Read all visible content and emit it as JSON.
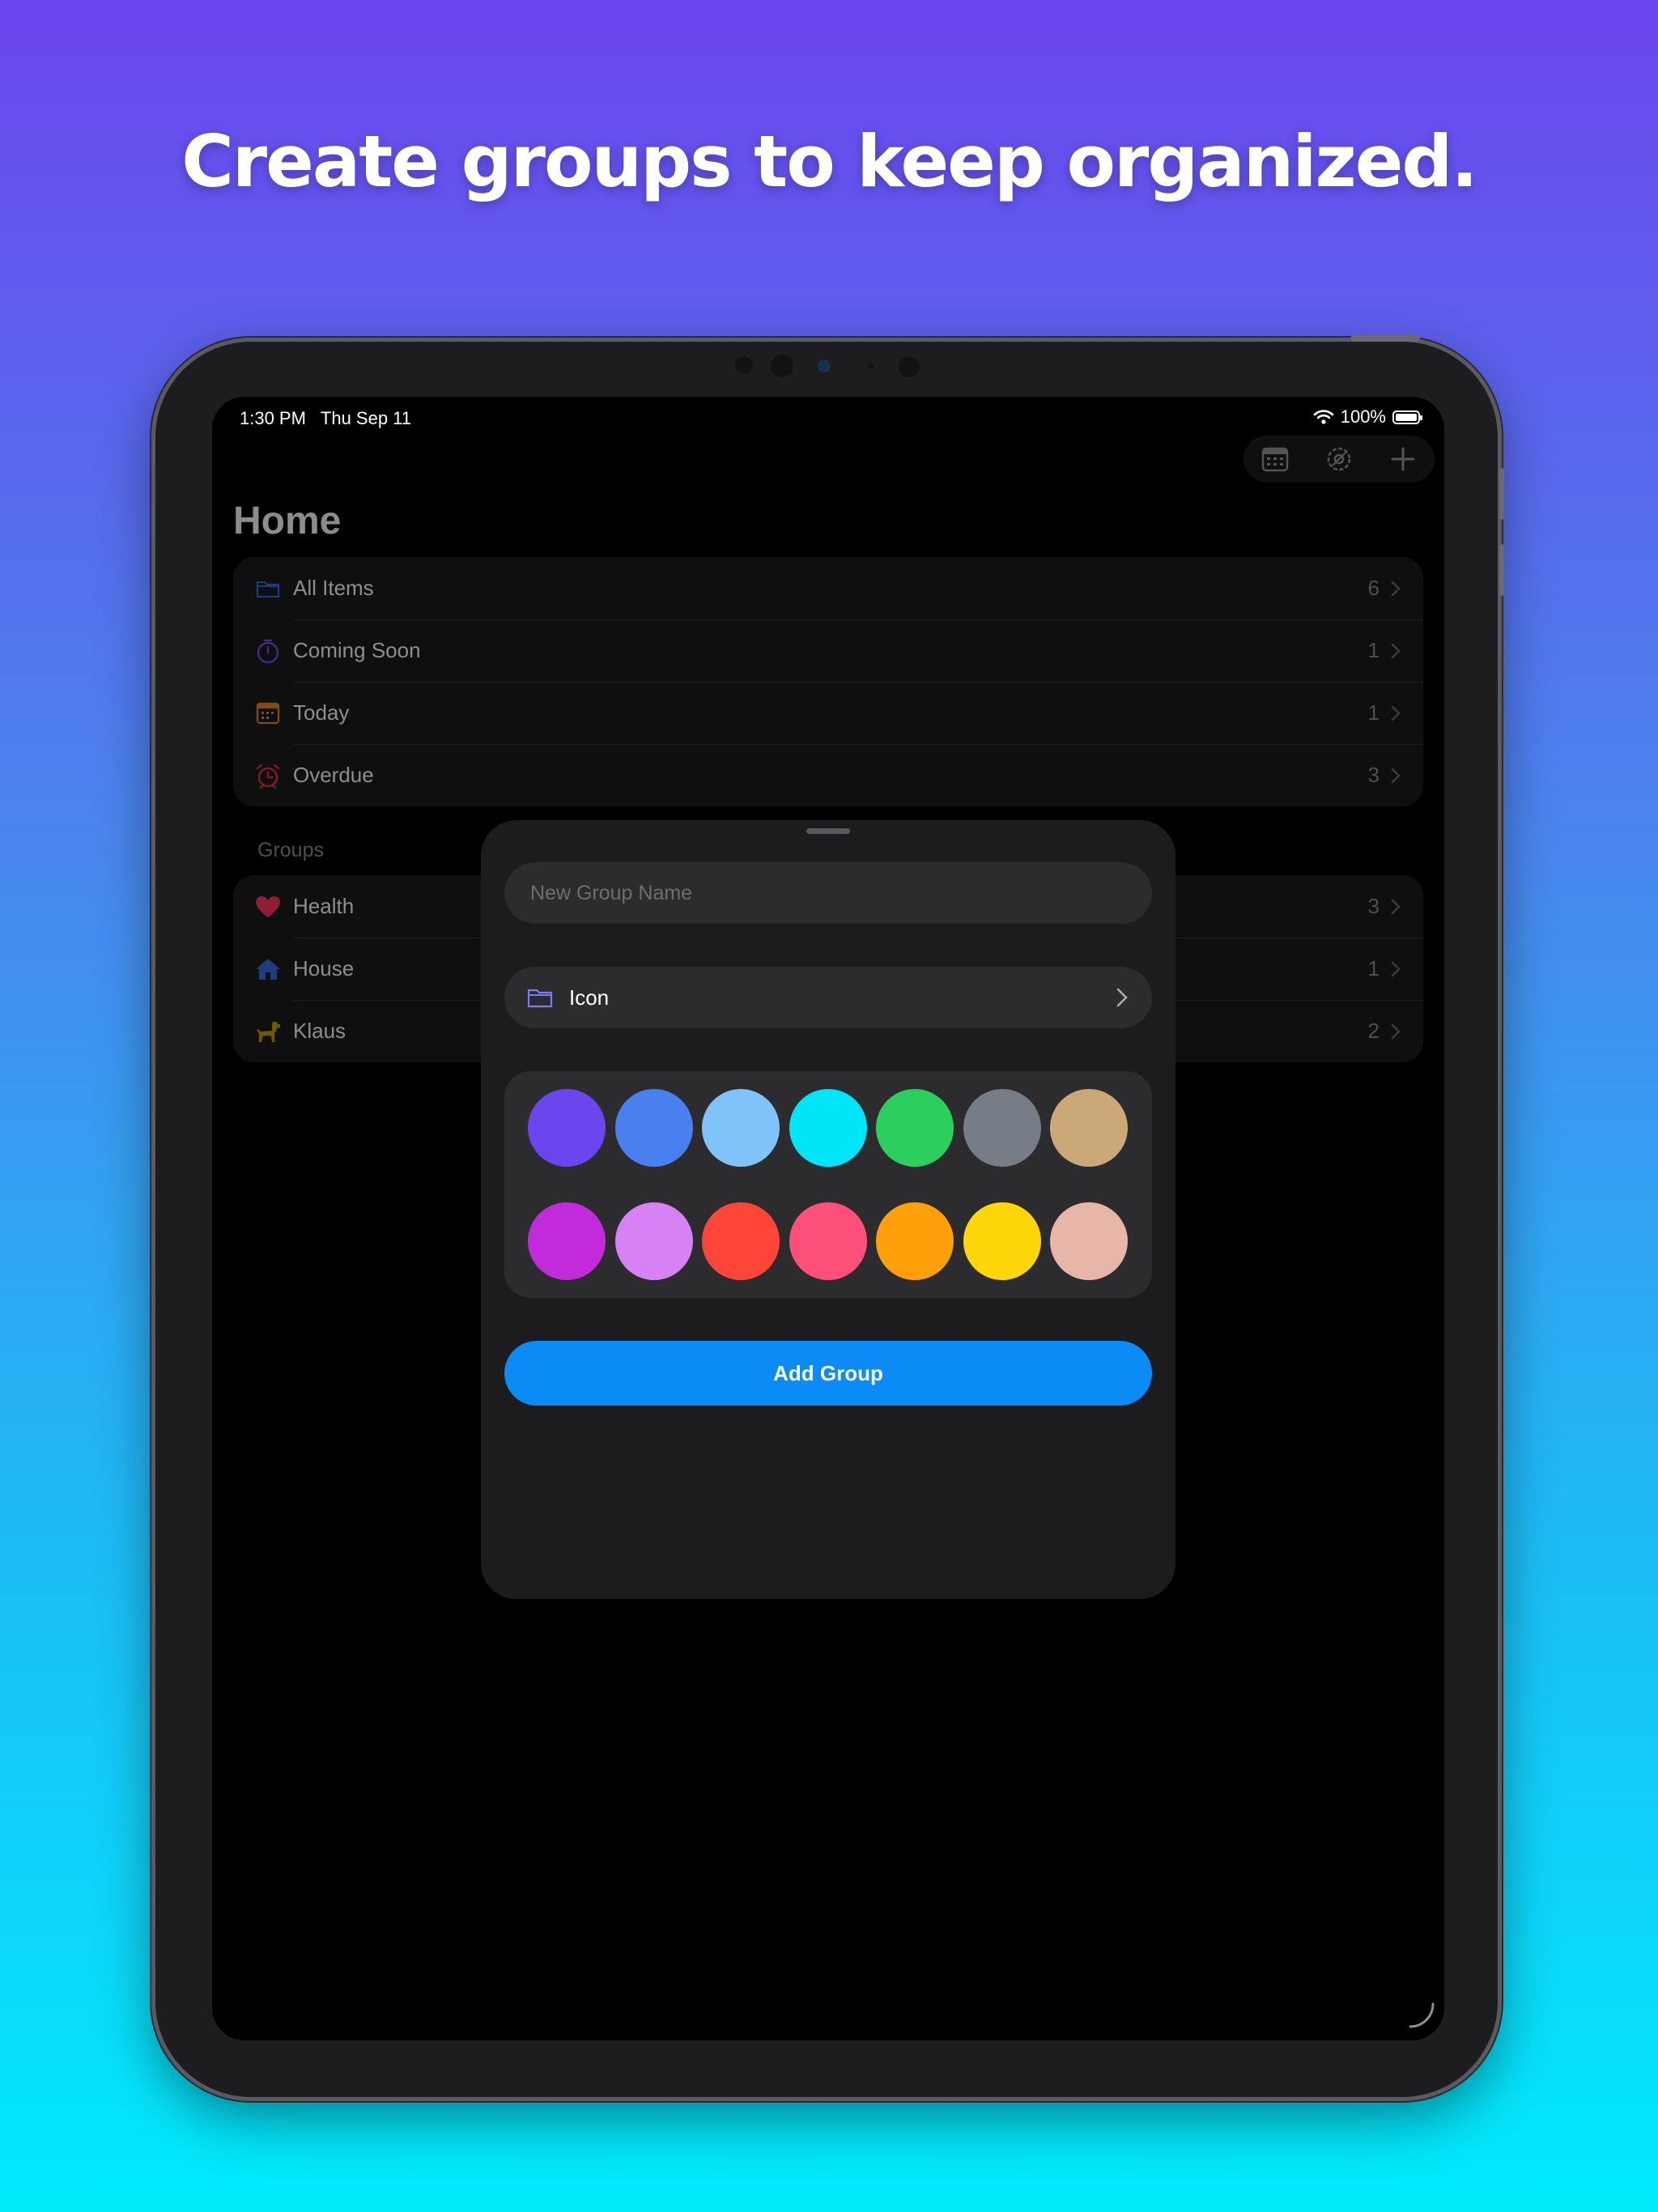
{
  "headline": "Create groups to keep organized.",
  "status_bar": {
    "time": "1:30 PM",
    "date": "Thu Sep 11",
    "battery": "100%"
  },
  "toolbar": {
    "calendar": "calendar-icon",
    "settings": "gear-icon",
    "add": "plus-icon"
  },
  "home": {
    "title": "Home",
    "smart_lists": [
      {
        "label": "All Items",
        "count": "6",
        "icon": "folder-icon",
        "color": "#2f6fe0"
      },
      {
        "label": "Coming Soon",
        "count": "1",
        "icon": "timer-icon",
        "color": "#7b4df0"
      },
      {
        "label": "Today",
        "count": "1",
        "icon": "calendar-icon",
        "color": "#e8892f"
      },
      {
        "label": "Overdue",
        "count": "3",
        "icon": "alarm-icon",
        "color": "#e53935"
      }
    ],
    "groups_label": "Groups",
    "groups": [
      {
        "label": "Health",
        "count": "3",
        "icon": "heart-icon",
        "color": "#ff3b5c"
      },
      {
        "label": "House",
        "count": "1",
        "icon": "house-icon",
        "color": "#3a6de6"
      },
      {
        "label": "Klaus",
        "count": "2",
        "icon": "dog-icon",
        "color": "#c9a000"
      }
    ]
  },
  "sheet": {
    "name_placeholder": "New Group Name",
    "name_value": "",
    "icon_label": "Icon",
    "icon_name": "folder-icon",
    "colors": [
      "#6b45ee",
      "#4a7ff0",
      "#7fc3fa",
      "#00e5f7",
      "#2ccf5e",
      "#767d87",
      "#cba877",
      "#c22bd9",
      "#d681f4",
      "#ff4538",
      "#ff4f7a",
      "#ff9f0a",
      "#ffd60a",
      "#e8b5a9"
    ],
    "add_button": "Add Group"
  }
}
